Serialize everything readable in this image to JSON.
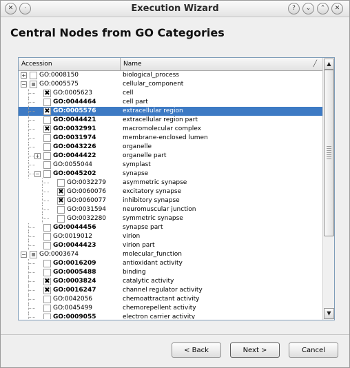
{
  "window": {
    "title": "Execution Wizard",
    "buttons": {
      "help": "?",
      "minimize": "⌄",
      "maximize": "⌃",
      "close": "✕"
    }
  },
  "page_title": "Central Nodes from GO Categories",
  "table": {
    "columns": {
      "accession": "Accession",
      "name": "Name"
    },
    "rows": [
      {
        "accession": "GO:0008150",
        "name": "biological_process",
        "bold": false,
        "checkbox": "unchecked",
        "expander": "plus",
        "selected": false
      },
      {
        "accession": "GO:0005575",
        "name": "cellular_component",
        "bold": false,
        "checkbox": "partial",
        "expander": "minus",
        "selected": false
      },
      {
        "accession": "GO:0005623",
        "name": "cell",
        "bold": false,
        "checkbox": "checked",
        "expander": "",
        "selected": false
      },
      {
        "accession": "GO:0044464",
        "name": "cell part",
        "bold": true,
        "checkbox": "unchecked",
        "expander": "",
        "selected": false
      },
      {
        "accession": "GO:0005576",
        "name": "extracellular region",
        "bold": true,
        "checkbox": "checked",
        "expander": "",
        "selected": true
      },
      {
        "accession": "GO:0044421",
        "name": "extracellular region part",
        "bold": true,
        "checkbox": "unchecked",
        "expander": "",
        "selected": false
      },
      {
        "accession": "GO:0032991",
        "name": "macromolecular complex",
        "bold": true,
        "checkbox": "checked",
        "expander": "",
        "selected": false
      },
      {
        "accession": "GO:0031974",
        "name": "membrane-enclosed lumen",
        "bold": true,
        "checkbox": "unchecked",
        "expander": "",
        "selected": false
      },
      {
        "accession": "GO:0043226",
        "name": "organelle",
        "bold": true,
        "checkbox": "unchecked",
        "expander": "",
        "selected": false
      },
      {
        "accession": "GO:0044422",
        "name": "organelle part",
        "bold": true,
        "checkbox": "unchecked",
        "expander": "plus",
        "selected": false
      },
      {
        "accession": "GO:0055044",
        "name": "symplast",
        "bold": false,
        "checkbox": "unchecked",
        "expander": "",
        "selected": false
      },
      {
        "accession": "GO:0045202",
        "name": "synapse",
        "bold": true,
        "checkbox": "unchecked",
        "expander": "minus",
        "selected": false
      },
      {
        "accession": "GO:0032279",
        "name": "asymmetric synapse",
        "bold": false,
        "checkbox": "unchecked",
        "expander": "",
        "selected": false
      },
      {
        "accession": "GO:0060076",
        "name": "excitatory synapse",
        "bold": false,
        "checkbox": "checked",
        "expander": "",
        "selected": false
      },
      {
        "accession": "GO:0060077",
        "name": "inhibitory synapse",
        "bold": false,
        "checkbox": "checked",
        "expander": "",
        "selected": false
      },
      {
        "accession": "GO:0031594",
        "name": "neuromuscular junction",
        "bold": false,
        "checkbox": "unchecked",
        "expander": "",
        "selected": false
      },
      {
        "accession": "GO:0032280",
        "name": "symmetric synapse",
        "bold": false,
        "checkbox": "unchecked",
        "expander": "",
        "selected": false
      },
      {
        "accession": "GO:0044456",
        "name": "synapse part",
        "bold": true,
        "checkbox": "unchecked",
        "expander": "",
        "selected": false
      },
      {
        "accession": "GO:0019012",
        "name": "virion",
        "bold": false,
        "checkbox": "unchecked",
        "expander": "",
        "selected": false
      },
      {
        "accession": "GO:0044423",
        "name": "virion part",
        "bold": true,
        "checkbox": "unchecked",
        "expander": "",
        "selected": false
      },
      {
        "accession": "GO:0003674",
        "name": "molecular_function",
        "bold": false,
        "checkbox": "partial",
        "expander": "minus",
        "selected": false
      },
      {
        "accession": "GO:0016209",
        "name": "antioxidant activity",
        "bold": true,
        "checkbox": "unchecked",
        "expander": "",
        "selected": false
      },
      {
        "accession": "GO:0005488",
        "name": "binding",
        "bold": true,
        "checkbox": "unchecked",
        "expander": "",
        "selected": false
      },
      {
        "accession": "GO:0003824",
        "name": "catalytic activity",
        "bold": true,
        "checkbox": "checked",
        "expander": "",
        "selected": false
      },
      {
        "accession": "GO:0016247",
        "name": "channel regulator activity",
        "bold": true,
        "checkbox": "checked",
        "expander": "",
        "selected": false
      },
      {
        "accession": "GO:0042056",
        "name": "chemoattractant activity",
        "bold": false,
        "checkbox": "unchecked",
        "expander": "",
        "selected": false
      },
      {
        "accession": "GO:0045499",
        "name": "chemorepellent activity",
        "bold": false,
        "checkbox": "unchecked",
        "expander": "",
        "selected": false
      },
      {
        "accession": "GO:0009055",
        "name": "electron carrier activity",
        "bold": true,
        "checkbox": "unchecked",
        "expander": "",
        "selected": false
      }
    ]
  },
  "footer": {
    "back_label": "< Back",
    "next_label": "Next >",
    "cancel_label": "Cancel"
  },
  "colors": {
    "selection": "#3d7ac4"
  }
}
